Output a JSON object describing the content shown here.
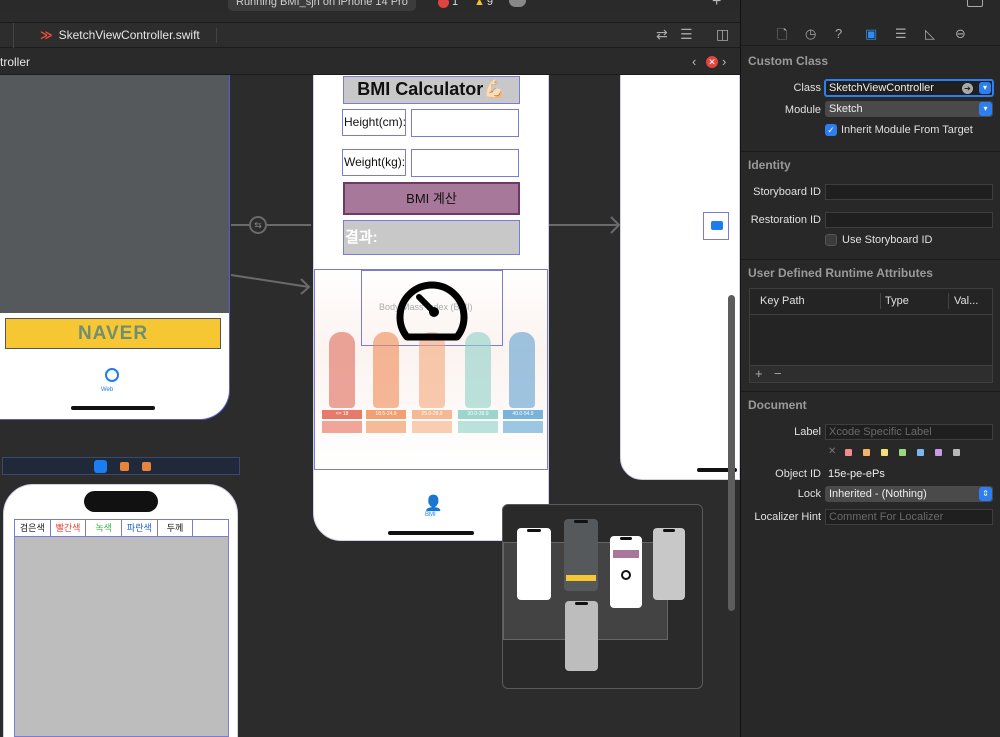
{
  "status": {
    "running_text": "Running BMI_sjh on iPhone 14 Pro",
    "errors": "1",
    "warnings": "9"
  },
  "tab": {
    "file_name": "SketchViewController.swift"
  },
  "jumpbar": {
    "crumb": "troller"
  },
  "canvas": {
    "naver_label": "NAVER",
    "web_tab_label": "Web",
    "bmi_title": "BMI Calculator💪🏻",
    "height_label": "Height(cm):",
    "weight_label": "Weight(kg):",
    "calc_button": "BMI 계산",
    "result_label": "결과:",
    "chart_caption": "Body Mass Index (BMI)",
    "bmi_ranges": [
      "<= 18",
      "18.5-24.9",
      "25.0-29.9",
      "30.0-39.9",
      "40.0-54.9"
    ],
    "bmi_tab_label": "BMI",
    "color_headers": [
      "검은색",
      "빨간색",
      "녹색",
      "파란색",
      "두께",
      ""
    ]
  },
  "inspector": {
    "custom_class": {
      "title": "Custom Class",
      "class_label": "Class",
      "class_value": "SketchViewController",
      "module_label": "Module",
      "module_value": "Sketch",
      "inherit_label": "Inherit Module From Target",
      "inherit_checked": true
    },
    "identity": {
      "title": "Identity",
      "storyboard_id_label": "Storyboard ID",
      "storyboard_id_value": "",
      "restoration_id_label": "Restoration ID",
      "restoration_id_value": "",
      "use_storyboard_id_label": "Use Storyboard ID",
      "use_storyboard_id_checked": false
    },
    "runtime_attributes": {
      "title": "User Defined Runtime Attributes",
      "columns": [
        "Key Path",
        "Type",
        "Val..."
      ]
    },
    "document": {
      "title": "Document",
      "label_label": "Label",
      "label_placeholder": "Xcode Specific Label",
      "object_id_label": "Object ID",
      "object_id_value": "15e-pe-ePs",
      "lock_label": "Lock",
      "lock_value": "Inherited - (Nothing)",
      "localizer_label": "Localizer Hint",
      "localizer_placeholder": "Comment For Localizer",
      "swatch_colors": [
        "#f08c8c",
        "#f5b36b",
        "#f2e07a",
        "#9ad97b",
        "#7bb6ef",
        "#c99ae8",
        "#b8b8b8"
      ]
    }
  },
  "colors": {
    "accent": "#2d7ff0",
    "naver_yellow": "#f7c633",
    "bmi_button": "#a8789a"
  }
}
